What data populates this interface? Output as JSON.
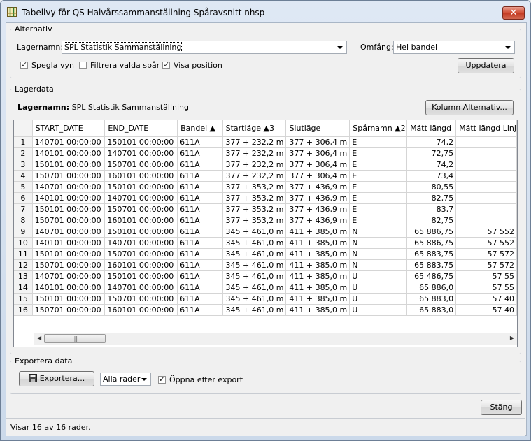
{
  "window": {
    "title": "Tabellvy för QS Halvårssammanställning Spåravsnitt nhsp",
    "close_glyph": "✕"
  },
  "alternativ": {
    "legend": "Alternativ",
    "layer_label": "Lagernamn:",
    "layer_value": "SPL Statistik Sammanställning",
    "scope_label": "Omfång:",
    "scope_value": "Hel bandel",
    "mirror_label": "Spegla vyn",
    "filter_label": "Filtrera valda spår",
    "position_label": "Visa position",
    "update_label": "Uppdatera"
  },
  "lagerdata": {
    "legend": "Lagerdata",
    "layer_bold": "Lagernamn:",
    "layer_name": "SPL Statistik Sammanställning",
    "column_options_label": "Kolumn Alternativ...",
    "columns": [
      "START_DATE",
      "END_DATE",
      "Bandel ▲",
      "Startläge ▲3",
      "Slutläge",
      "Spårnamn ▲2",
      "Mätt längd",
      "Mätt längd Linj"
    ],
    "rows": [
      [
        "1",
        "140701 00:00:00",
        "150101 00:00:00",
        "611A",
        "377 + 232,2 m",
        "377 + 306,4 m",
        "E",
        "74,2",
        ""
      ],
      [
        "2",
        "140101 00:00:00",
        "140701 00:00:00",
        "611A",
        "377 + 232,2 m",
        "377 + 306,4 m",
        "E",
        "72,75",
        ""
      ],
      [
        "3",
        "150101 00:00:00",
        "150701 00:00:00",
        "611A",
        "377 + 232,2 m",
        "377 + 306,4 m",
        "E",
        "74,2",
        ""
      ],
      [
        "4",
        "150701 00:00:00",
        "160101 00:00:00",
        "611A",
        "377 + 232,2 m",
        "377 + 306,4 m",
        "E",
        "73,4",
        ""
      ],
      [
        "5",
        "140701 00:00:00",
        "150101 00:00:00",
        "611A",
        "377 + 353,2 m",
        "377 + 436,9 m",
        "E",
        "80,55",
        ""
      ],
      [
        "6",
        "140101 00:00:00",
        "140701 00:00:00",
        "611A",
        "377 + 353,2 m",
        "377 + 436,9 m",
        "E",
        "82,75",
        ""
      ],
      [
        "7",
        "150101 00:00:00",
        "150701 00:00:00",
        "611A",
        "377 + 353,2 m",
        "377 + 436,9 m",
        "E",
        "83,7",
        ""
      ],
      [
        "8",
        "150701 00:00:00",
        "160101 00:00:00",
        "611A",
        "377 + 353,2 m",
        "377 + 436,9 m",
        "E",
        "82,75",
        ""
      ],
      [
        "9",
        "140701 00:00:00",
        "150101 00:00:00",
        "611A",
        "345 + 461,0 m",
        "411 + 385,0 m",
        "N",
        "65 886,75",
        "57 552"
      ],
      [
        "10",
        "140101 00:00:00",
        "140701 00:00:00",
        "611A",
        "345 + 461,0 m",
        "411 + 385,0 m",
        "N",
        "65 886,75",
        "57 552"
      ],
      [
        "11",
        "150101 00:00:00",
        "150701 00:00:00",
        "611A",
        "345 + 461,0 m",
        "411 + 385,0 m",
        "N",
        "65 883,75",
        "57 572"
      ],
      [
        "12",
        "150701 00:00:00",
        "160101 00:00:00",
        "611A",
        "345 + 461,0 m",
        "411 + 385,0 m",
        "N",
        "65 883,75",
        "57 572"
      ],
      [
        "13",
        "140701 00:00:00",
        "150101 00:00:00",
        "611A",
        "345 + 461,0 m",
        "411 + 385,0 m",
        "U",
        "65 486,75",
        "57 55"
      ],
      [
        "14",
        "140101 00:00:00",
        "140701 00:00:00",
        "611A",
        "345 + 461,0 m",
        "411 + 385,0 m",
        "U",
        "65 886,0",
        "57 55"
      ],
      [
        "15",
        "150101 00:00:00",
        "150701 00:00:00",
        "611A",
        "345 + 461,0 m",
        "411 + 385,0 m",
        "U",
        "65 883,0",
        "57 40"
      ],
      [
        "16",
        "150701 00:00:00",
        "160101 00:00:00",
        "611A",
        "345 + 461,0 m",
        "411 + 385,0 m",
        "U",
        "65 883,0",
        "57 40"
      ]
    ]
  },
  "export": {
    "legend": "Exportera data",
    "export_label": "Exportera...",
    "rows_option": "Alla rader",
    "open_after_label": "Öppna efter export"
  },
  "close_label": "Stäng",
  "status": "Visar 16 av 16 rader.",
  "icons": {
    "app": "table-icon",
    "export": "floppy-disk-icon"
  }
}
